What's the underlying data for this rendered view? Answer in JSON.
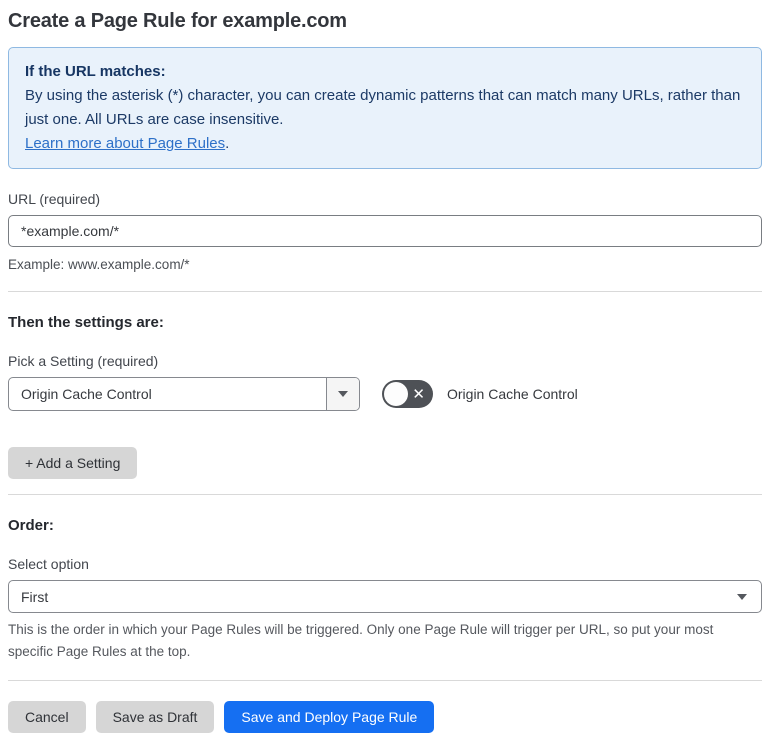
{
  "page": {
    "title": "Create a Page Rule for example.com"
  },
  "info_box": {
    "heading": "If the URL matches:",
    "body": "By using the asterisk (*) character, you can create dynamic patterns that can match many URLs, rather than just one. All URLs are case insensitive.",
    "link": "Learn more about Page Rules",
    "link_suffix": "."
  },
  "url_field": {
    "label": "URL (required)",
    "value": "*example.com/*",
    "helper": "Example: www.example.com/*"
  },
  "settings": {
    "heading": "Then the settings are:",
    "picker_label": "Pick a Setting (required)",
    "selected_setting": "Origin Cache Control",
    "toggle_label": "Origin Cache Control",
    "toggle_state": "off",
    "toggle_icon": "✕",
    "add_button": "+ Add a Setting"
  },
  "order": {
    "heading": "Order:",
    "label": "Select option",
    "selected": "First",
    "helper": "This is the order in which your Page Rules will be triggered. Only one Page Rule will trigger per URL, so put your most specific Page Rules at the top."
  },
  "footer": {
    "cancel": "Cancel",
    "save_draft": "Save as Draft",
    "save_deploy": "Save and Deploy Page Rule"
  },
  "colors": {
    "accent_blue": "#156FF2",
    "info_background": "#E9F2FB",
    "info_border": "#8FB9E2",
    "info_text": "#1C3A66",
    "link_blue": "#2D70C8",
    "toggle_gray": "#4E5156",
    "button_gray": "#D6D6D6"
  }
}
